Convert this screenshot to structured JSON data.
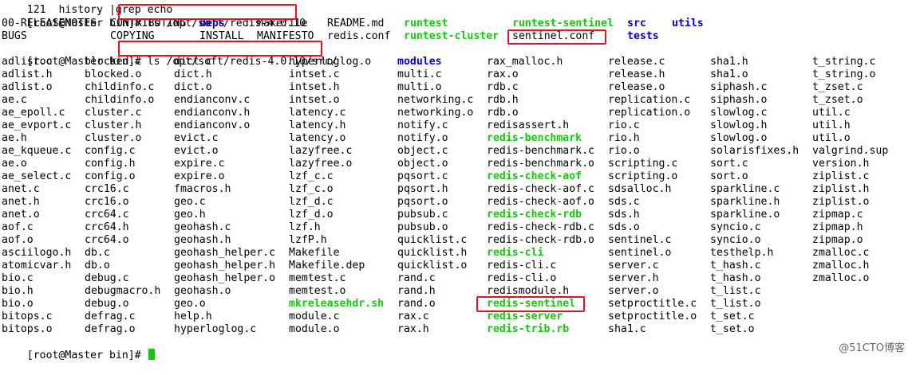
{
  "colors": {
    "executable": "#16c60c",
    "directory": "#0000cc",
    "highlight": "#e0141e",
    "text": "#000000",
    "background": "#ffffff"
  },
  "terminal": {
    "partial_top_line": "121  history |grep echo",
    "prompt": "[root@Master bin]# ",
    "commands": [
      {
        "command": "ls /opt/soft/redis-4.0.10"
      },
      {
        "command": "ls /opt/soft/redis-4.0.10/src/"
      },
      {
        "command": ""
      }
    ],
    "listing1": [
      [
        "00-RELEASENOTES",
        "CONTRIBUTING",
        "deps",
        "Makefile",
        "README.md",
        "runtest",
        "runtest-sentinel",
        "src",
        "utils"
      ],
      [
        "BUGS",
        "COPYING",
        "INSTALL",
        "MANIFESTO",
        "redis.conf",
        "runtest-cluster",
        "sentinel.conf",
        "tests"
      ]
    ],
    "listing1_types": [
      [
        "f",
        "f",
        "d",
        "f",
        "f",
        "x",
        "x",
        "d",
        "d"
      ],
      [
        "f",
        "f",
        "f",
        "f",
        "f",
        "x",
        "f",
        "d"
      ]
    ],
    "listing2": [
      [
        "adlist.c",
        "blocked.c",
        "dict.c",
        "hyperloglog.o",
        "modules",
        "rax_malloc.h",
        "release.c",
        "sha1.h",
        "t_string.c"
      ],
      [
        "adlist.h",
        "blocked.o",
        "dict.h",
        "intset.c",
        "multi.c",
        "rax.o",
        "release.h",
        "sha1.o",
        "t_string.o"
      ],
      [
        "adlist.o",
        "childinfo.c",
        "dict.o",
        "intset.h",
        "multi.o",
        "rdb.c",
        "release.o",
        "siphash.c",
        "t_zset.c"
      ],
      [
        "ae.c",
        "childinfo.o",
        "endianconv.c",
        "intset.o",
        "networking.c",
        "rdb.h",
        "replication.c",
        "siphash.o",
        "t_zset.o"
      ],
      [
        "ae_epoll.c",
        "cluster.c",
        "endianconv.h",
        "latency.c",
        "networking.o",
        "rdb.o",
        "replication.o",
        "slowlog.c",
        "util.c"
      ],
      [
        "ae_evport.c",
        "cluster.h",
        "endianconv.o",
        "latency.h",
        "notify.c",
        "redisassert.h",
        "rio.c",
        "slowlog.h",
        "util.h"
      ],
      [
        "ae.h",
        "cluster.o",
        "evict.c",
        "latency.o",
        "notify.o",
        "redis-benchmark",
        "rio.h",
        "slowlog.o",
        "util.o"
      ],
      [
        "ae_kqueue.c",
        "config.c",
        "evict.o",
        "lazyfree.c",
        "object.c",
        "redis-benchmark.c",
        "rio.o",
        "solarisfixes.h",
        "valgrind.sup"
      ],
      [
        "ae.o",
        "config.h",
        "expire.c",
        "lazyfree.o",
        "object.o",
        "redis-benchmark.o",
        "scripting.c",
        "sort.c",
        "version.h"
      ],
      [
        "ae_select.c",
        "config.o",
        "expire.o",
        "lzf_c.c",
        "pqsort.c",
        "redis-check-aof",
        "scripting.o",
        "sort.o",
        "ziplist.c"
      ],
      [
        "anet.c",
        "crc16.c",
        "fmacros.h",
        "lzf_c.o",
        "pqsort.h",
        "redis-check-aof.c",
        "sdsalloc.h",
        "sparkline.c",
        "ziplist.h"
      ],
      [
        "anet.h",
        "crc16.o",
        "geo.c",
        "lzf_d.c",
        "pqsort.o",
        "redis-check-aof.o",
        "sds.c",
        "sparkline.h",
        "ziplist.o"
      ],
      [
        "anet.o",
        "crc64.c",
        "geo.h",
        "lzf_d.o",
        "pubsub.c",
        "redis-check-rdb",
        "sds.h",
        "sparkline.o",
        "zipmap.c"
      ],
      [
        "aof.c",
        "crc64.h",
        "geohash.c",
        "lzf.h",
        "pubsub.o",
        "redis-check-rdb.c",
        "sds.o",
        "syncio.c",
        "zipmap.h"
      ],
      [
        "aof.o",
        "crc64.o",
        "geohash.h",
        "lzfP.h",
        "quicklist.c",
        "redis-check-rdb.o",
        "sentinel.c",
        "syncio.o",
        "zipmap.o"
      ],
      [
        "asciilogo.h",
        "db.c",
        "geohash_helper.c",
        "Makefile",
        "quicklist.h",
        "redis-cli",
        "sentinel.o",
        "testhelp.h",
        "zmalloc.c"
      ],
      [
        "atomicvar.h",
        "db.o",
        "geohash_helper.h",
        "Makefile.dep",
        "quicklist.o",
        "redis-cli.c",
        "server.c",
        "t_hash.c",
        "zmalloc.h"
      ],
      [
        "bio.c",
        "debug.c",
        "geohash_helper.o",
        "memtest.c",
        "rand.c",
        "redis-cli.o",
        "server.h",
        "t_hash.o",
        "zmalloc.o"
      ],
      [
        "bio.h",
        "debugmacro.h",
        "geohash.o",
        "memtest.o",
        "rand.h",
        "redismodule.h",
        "server.o",
        "t_list.c"
      ],
      [
        "bio.o",
        "debug.o",
        "geo.o",
        "mkreleasehdr.sh",
        "rand.o",
        "redis-sentinel",
        "setproctitle.c",
        "t_list.o"
      ],
      [
        "bitops.c",
        "defrag.c",
        "help.h",
        "module.c",
        "rax.c",
        "redis-server",
        "setproctitle.o",
        "t_set.c"
      ],
      [
        "bitops.o",
        "defrag.o",
        "hyperloglog.c",
        "module.o",
        "rax.h",
        "redis-trib.rb",
        "sha1.c",
        "t_set.o"
      ]
    ],
    "listing2_types": [
      [
        "f",
        "f",
        "f",
        "f",
        "d",
        "f",
        "f",
        "f",
        "f"
      ],
      [
        "f",
        "f",
        "f",
        "f",
        "f",
        "f",
        "f",
        "f",
        "f"
      ],
      [
        "f",
        "f",
        "f",
        "f",
        "f",
        "f",
        "f",
        "f",
        "f"
      ],
      [
        "f",
        "f",
        "f",
        "f",
        "f",
        "f",
        "f",
        "f",
        "f"
      ],
      [
        "f",
        "f",
        "f",
        "f",
        "f",
        "f",
        "f",
        "f",
        "f"
      ],
      [
        "f",
        "f",
        "f",
        "f",
        "f",
        "f",
        "f",
        "f",
        "f"
      ],
      [
        "f",
        "f",
        "f",
        "f",
        "f",
        "x",
        "f",
        "f",
        "f"
      ],
      [
        "f",
        "f",
        "f",
        "f",
        "f",
        "f",
        "f",
        "f",
        "f"
      ],
      [
        "f",
        "f",
        "f",
        "f",
        "f",
        "f",
        "f",
        "f",
        "f"
      ],
      [
        "f",
        "f",
        "f",
        "f",
        "f",
        "x",
        "f",
        "f",
        "f"
      ],
      [
        "f",
        "f",
        "f",
        "f",
        "f",
        "f",
        "f",
        "f",
        "f"
      ],
      [
        "f",
        "f",
        "f",
        "f",
        "f",
        "f",
        "f",
        "f",
        "f"
      ],
      [
        "f",
        "f",
        "f",
        "f",
        "f",
        "x",
        "f",
        "f",
        "f"
      ],
      [
        "f",
        "f",
        "f",
        "f",
        "f",
        "f",
        "f",
        "f",
        "f"
      ],
      [
        "f",
        "f",
        "f",
        "f",
        "f",
        "f",
        "f",
        "f",
        "f"
      ],
      [
        "f",
        "f",
        "f",
        "f",
        "f",
        "x",
        "f",
        "f",
        "f"
      ],
      [
        "f",
        "f",
        "f",
        "f",
        "f",
        "f",
        "f",
        "f",
        "f"
      ],
      [
        "f",
        "f",
        "f",
        "f",
        "f",
        "f",
        "f",
        "f",
        "f"
      ],
      [
        "f",
        "f",
        "f",
        "f",
        "f",
        "f",
        "f",
        "f"
      ],
      [
        "f",
        "f",
        "f",
        "x",
        "f",
        "x",
        "f",
        "f"
      ],
      [
        "f",
        "f",
        "f",
        "f",
        "f",
        "x",
        "f",
        "f"
      ],
      [
        "f",
        "f",
        "f",
        "f",
        "f",
        "x",
        "f",
        "f"
      ]
    ],
    "watermark": "@51CTO博客"
  }
}
